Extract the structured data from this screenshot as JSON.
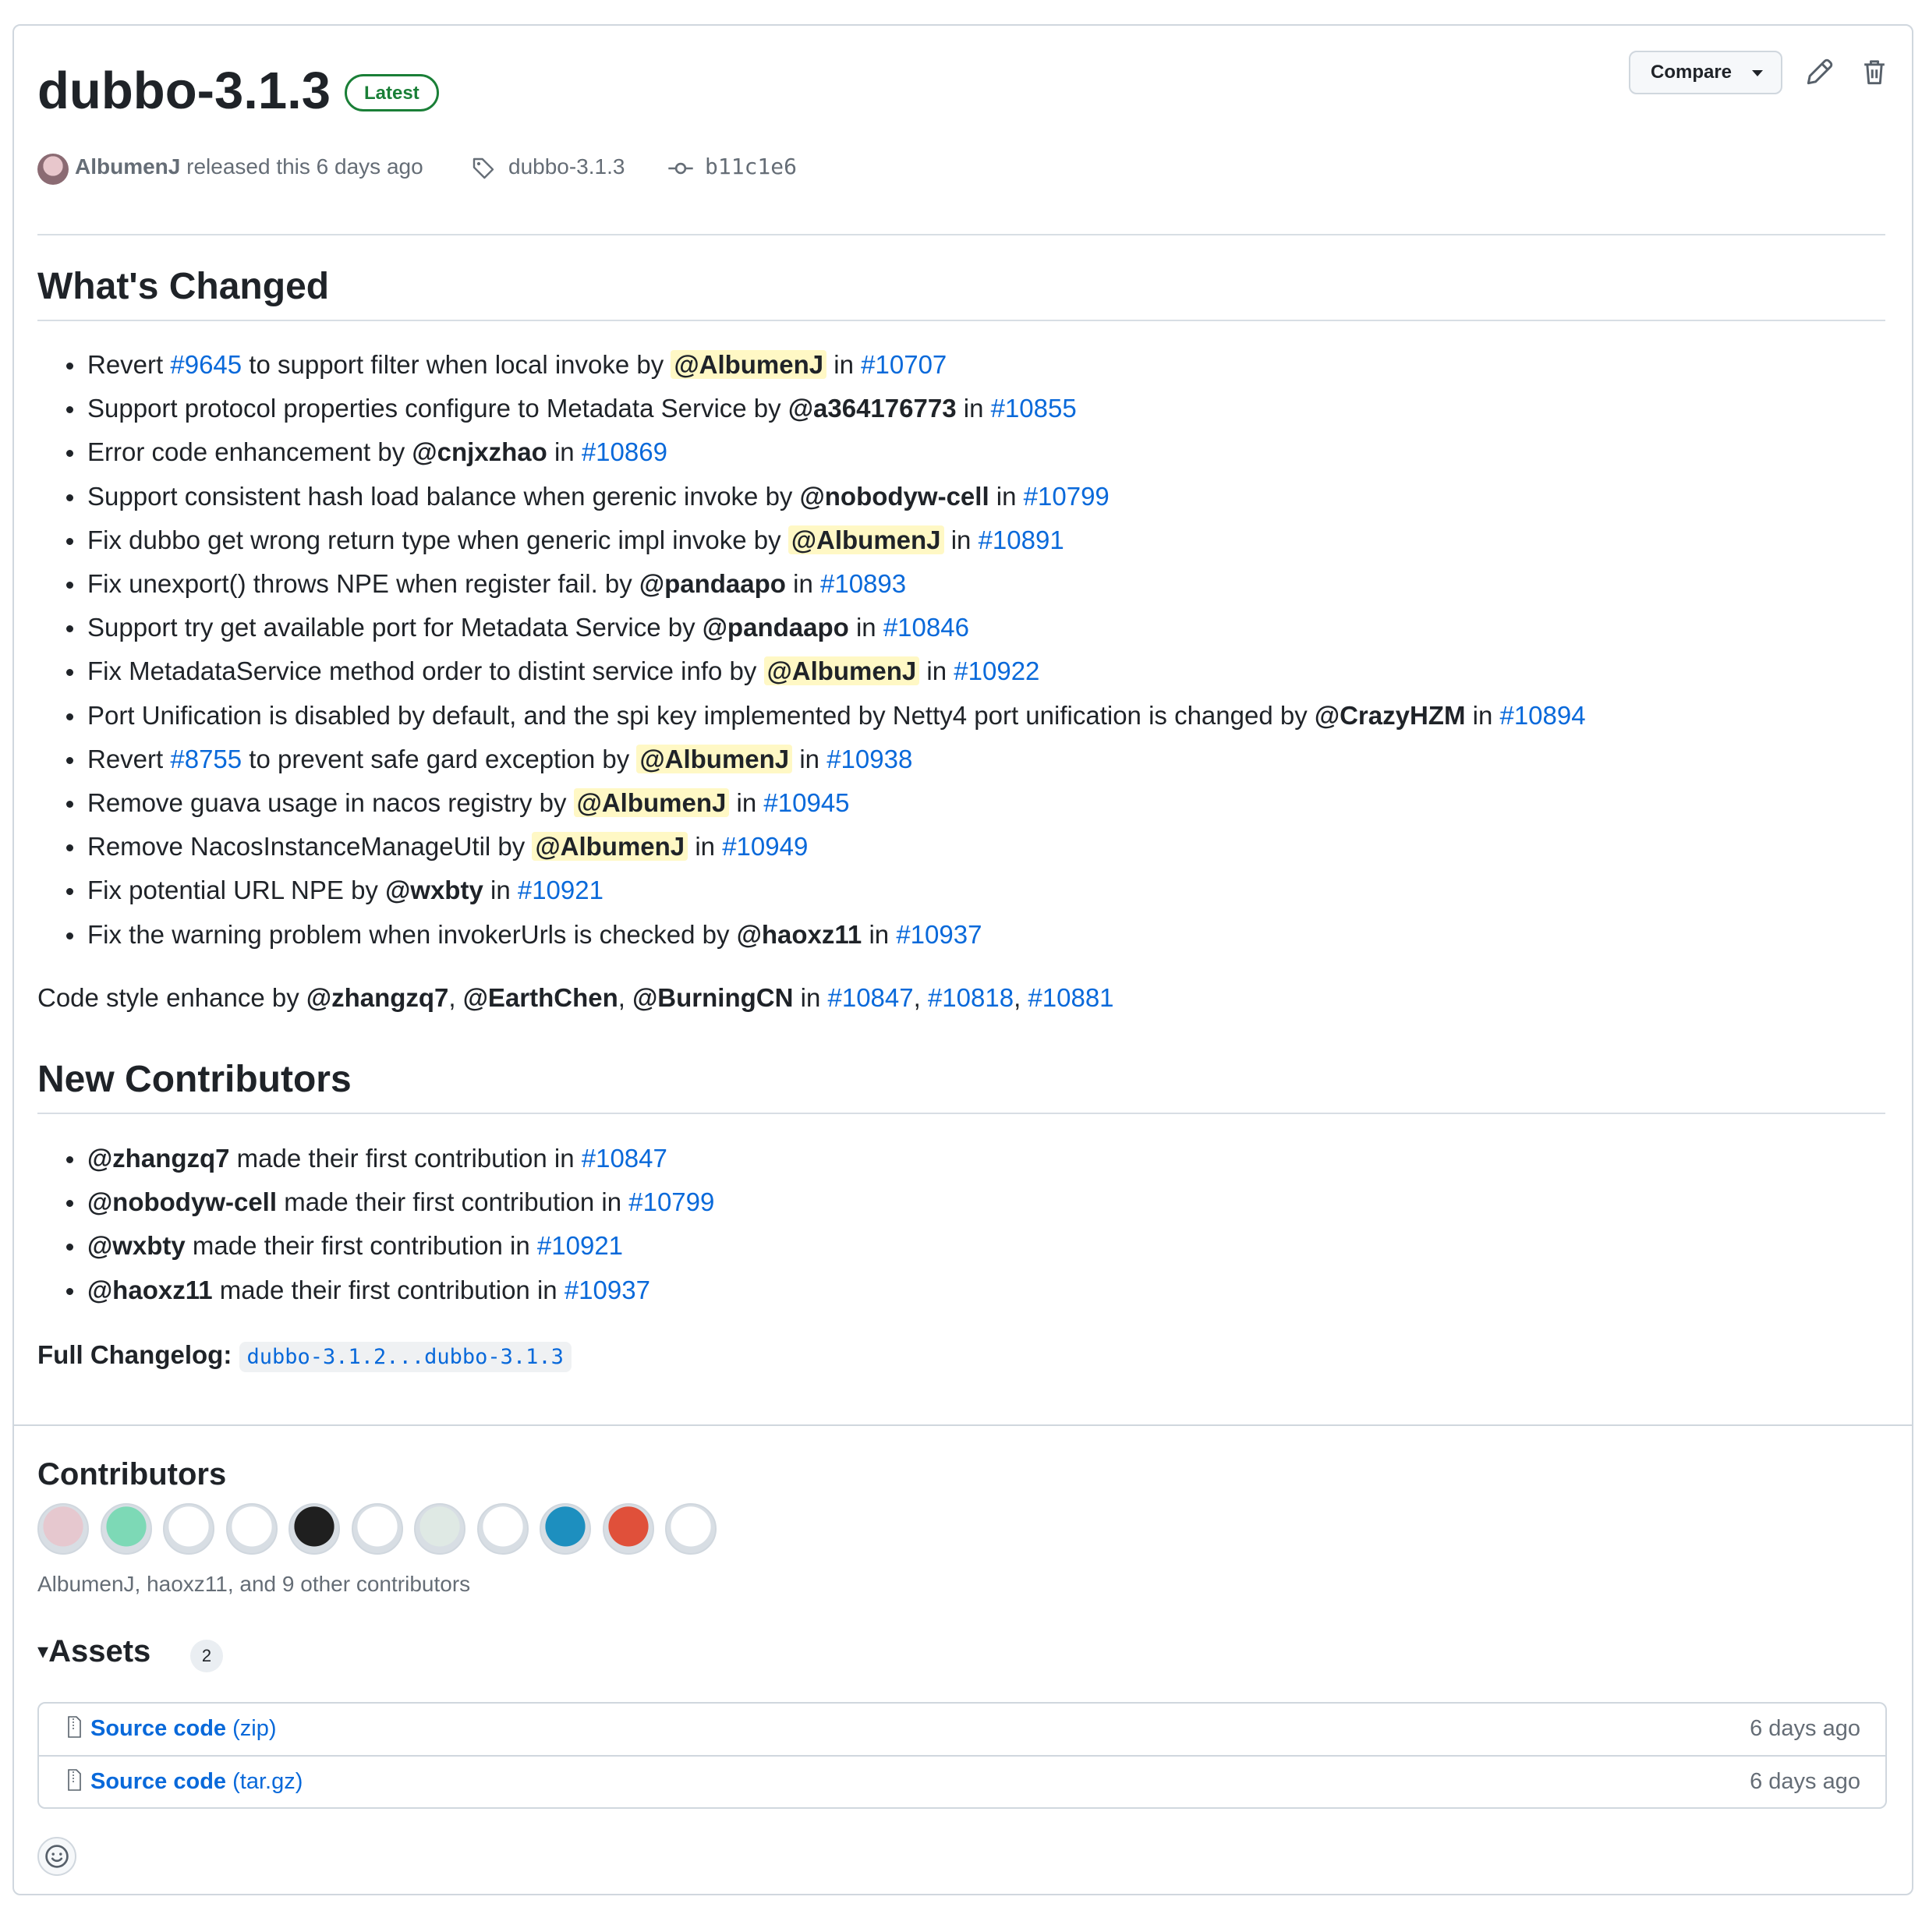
{
  "release": {
    "title": "dubbo-3.1.3",
    "badge": "Latest",
    "compare_label": "Compare",
    "author": "AlbumenJ",
    "released_text": "released this 6 days ago",
    "tag": "dubbo-3.1.3",
    "commit": "b11c1e6"
  },
  "whats_changed": {
    "heading": "What's Changed",
    "items": [
      {
        "pre": "Revert ",
        "ref": "#9645",
        "text": " to support filter when local invoke by ",
        "user": "@AlbumenJ",
        "highlight": true,
        "in": " in ",
        "pr": "#10707"
      },
      {
        "text": "Support protocol properties configure to Metadata Service by ",
        "user": "@a364176773",
        "in": " in ",
        "pr": "#10855"
      },
      {
        "text": "Error code enhancement by ",
        "user": "@cnjxzhao",
        "in": " in ",
        "pr": "#10869"
      },
      {
        "text": "Support consistent hash load balance when gerenic invoke by ",
        "user": "@nobodyw-cell",
        "in": " in ",
        "pr": "#10799"
      },
      {
        "text": "Fix dubbo get wrong return type when generic impl invoke by ",
        "user": "@AlbumenJ",
        "highlight": true,
        "in": " in ",
        "pr": "#10891"
      },
      {
        "text": "Fix unexport() throws NPE when register fail. by ",
        "user": "@pandaapo",
        "in": " in ",
        "pr": "#10893"
      },
      {
        "text": "Support try get available port for Metadata Service by ",
        "user": "@pandaapo",
        "in": " in ",
        "pr": "#10846"
      },
      {
        "text": "Fix MetadataService method order to distint service info by ",
        "user": "@AlbumenJ",
        "highlight": true,
        "in": " in ",
        "pr": "#10922"
      },
      {
        "text": "Port Unification is disabled by default, and the spi key implemented by Netty4 port unification is changed by ",
        "user": "@CrazyHZM",
        "in": " in ",
        "pr": "#10894"
      },
      {
        "pre": "Revert ",
        "ref": "#8755",
        "text": " to prevent safe gard exception by ",
        "user": "@AlbumenJ",
        "highlight": true,
        "in": " in ",
        "pr": "#10938"
      },
      {
        "text": "Remove guava usage in nacos registry by ",
        "user": "@AlbumenJ",
        "highlight": true,
        "in": " in ",
        "pr": "#10945"
      },
      {
        "text": "Remove NacosInstanceManageUtil by ",
        "user": "@AlbumenJ",
        "highlight": true,
        "in": " in ",
        "pr": "#10949"
      },
      {
        "text": "Fix potential URL NPE by ",
        "user": "@wxbty",
        "in": " in ",
        "pr": "#10921"
      },
      {
        "text": "Fix the warning problem when invokerUrls is checked by ",
        "user": "@haoxz11",
        "in": " in ",
        "pr": "#10937"
      }
    ],
    "code_style": {
      "pre": "Code style enhance by ",
      "users": [
        "@zhangzq7",
        "@EarthChen",
        "@BurningCN"
      ],
      "in": " in ",
      "prs": [
        "#10847",
        "#10818",
        "#10881"
      ]
    }
  },
  "new_contributors": {
    "heading": "New Contributors",
    "items": [
      {
        "user": "@zhangzq7",
        "text": " made their first contribution in ",
        "pr": "#10847"
      },
      {
        "user": "@nobodyw-cell",
        "text": " made their first contribution in ",
        "pr": "#10799"
      },
      {
        "user": "@wxbty",
        "text": " made their first contribution in ",
        "pr": "#10921"
      },
      {
        "user": "@haoxz11",
        "text": " made their first contribution in ",
        "pr": "#10937"
      }
    ]
  },
  "full_changelog": {
    "label": "Full Changelog",
    "colon": ":",
    "link": "dubbo-3.1.2...dubbo-3.1.3"
  },
  "contributors": {
    "heading": "Contributors",
    "summary": "AlbumenJ, haoxz11, and 9 other contributors",
    "avatar_colors": [
      "#e6c8cf",
      "#7dd9b6",
      "#ffffff",
      "#ffffff",
      "#1f1f1f",
      "#ffffff",
      "#dfe9e4",
      "#ffffff",
      "#1d8fbf",
      "#e0503a",
      "#ffffff"
    ]
  },
  "assets": {
    "heading": "Assets",
    "count": "2",
    "items": [
      {
        "name": "Source code",
        "ext": "(zip)",
        "date": "6 days ago"
      },
      {
        "name": "Source code",
        "ext": "(tar.gz)",
        "date": "6 days ago"
      }
    ]
  },
  "colors": {
    "link": "#0969da",
    "latest": "#1a7f37",
    "highlight": "#fff8c5"
  }
}
